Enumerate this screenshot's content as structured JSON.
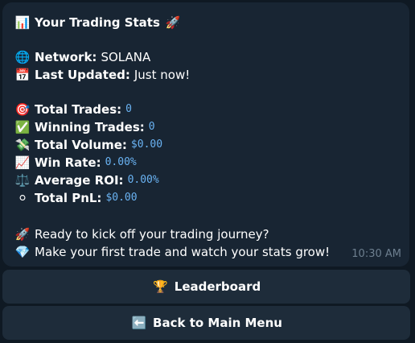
{
  "message": {
    "title_icon": "📊",
    "title": "Your Trading Stats",
    "title_suffix_icon": "🚀",
    "network": {
      "icon": "🌐",
      "label": "Network:",
      "value": "SOLANA"
    },
    "last_updated": {
      "icon": "📅",
      "label": "Last Updated:",
      "value": "Just now!"
    },
    "stats": [
      {
        "icon": "🎯",
        "label": "Total Trades:",
        "value": "0"
      },
      {
        "icon": "✅",
        "label": "Winning Trades:",
        "value": "0"
      },
      {
        "icon": "💸",
        "label": "Total Volume:",
        "value": "$0.00"
      },
      {
        "icon": "📈",
        "label": "Win Rate:",
        "value": "0.00%"
      },
      {
        "icon": "⚖️",
        "label": "Average ROI:",
        "value": "0.00%"
      },
      {
        "icon": "⚪",
        "label": "Total PnL:",
        "value": "$0.00"
      }
    ],
    "cta_1": {
      "icon": "🚀",
      "text": "Ready to kick off your trading journey?"
    },
    "cta_2": {
      "icon": "💎",
      "text": "Make your first trade and watch your stats grow!"
    },
    "timestamp": "10:30 AM"
  },
  "keyboard": {
    "leaderboard": {
      "icon": "🏆",
      "label": "Leaderboard"
    },
    "back": {
      "icon": "⬅️",
      "label": "Back to Main Menu"
    }
  }
}
